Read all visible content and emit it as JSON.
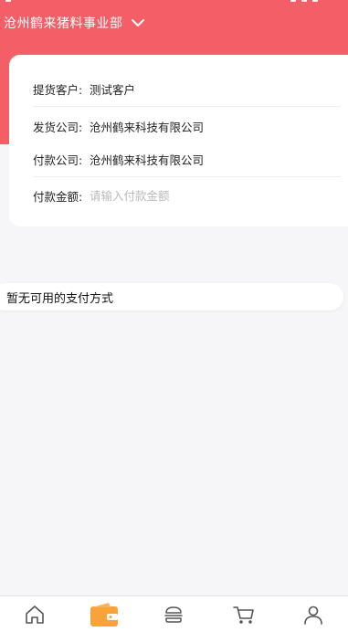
{
  "header": {
    "org_name": "沧州鹤来猪料事业部",
    "accent_color": "#f45e66"
  },
  "form": {
    "customer": {
      "label": "提货客户:",
      "value": "测试客户"
    },
    "shipper": {
      "label": "发货公司:",
      "value": "沧州鹤来科技有限公司"
    },
    "payer": {
      "label": "付款公司:",
      "value": "沧州鹤来科技有限公司"
    },
    "amount": {
      "label": "付款金额:",
      "value": "",
      "placeholder": "请输入付款金额"
    }
  },
  "notice": {
    "text": "暂无可用的支付方式"
  },
  "tabbar": {
    "items": [
      {
        "icon": "home-icon",
        "active": false
      },
      {
        "icon": "wallet-icon",
        "active": true
      },
      {
        "icon": "burger-icon",
        "active": false
      },
      {
        "icon": "cart-icon",
        "active": false
      },
      {
        "icon": "user-icon",
        "active": false
      }
    ],
    "active_color": "#f8a23a"
  }
}
